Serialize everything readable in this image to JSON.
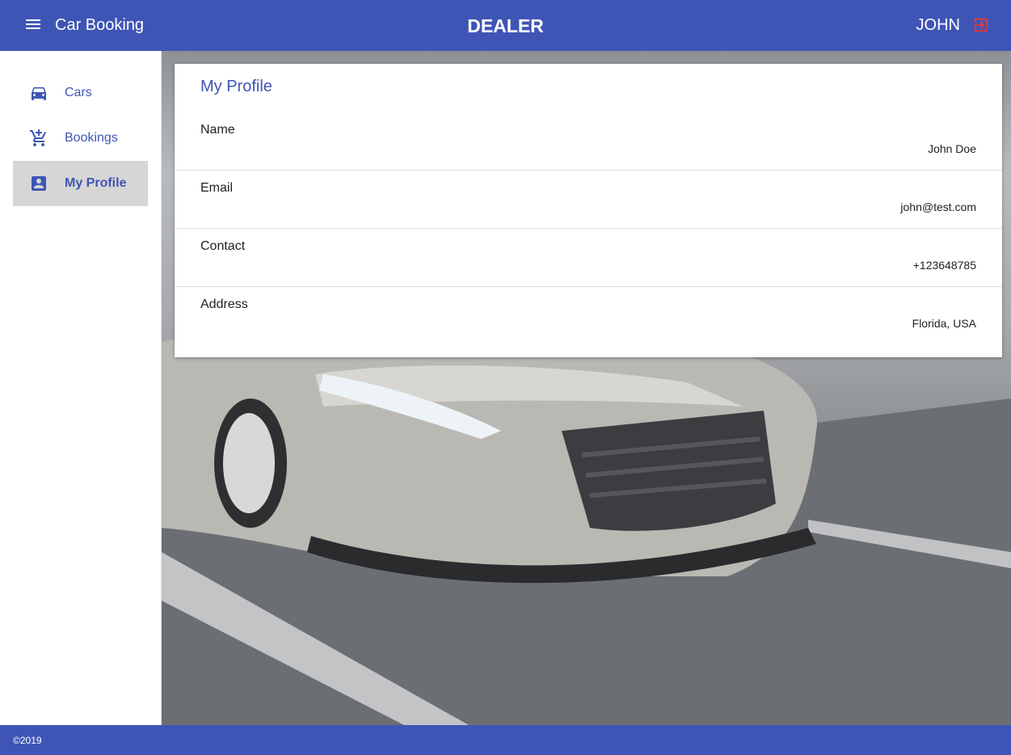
{
  "header": {
    "app_title": "Car Booking",
    "role": "DEALER",
    "user": "JOHN",
    "icons": {
      "menu": "menu-icon",
      "logout": "logout-icon"
    },
    "colors": {
      "bar": "#3f55b5",
      "logout_icon": "#e53935"
    }
  },
  "sidebar": {
    "items": [
      {
        "label": "Cars",
        "icon": "car-icon",
        "active": false
      },
      {
        "label": "Bookings",
        "icon": "add-shopping-cart-icon",
        "active": false
      },
      {
        "label": "My Profile",
        "icon": "account-box-icon",
        "active": true
      }
    ]
  },
  "profile": {
    "title": "My Profile",
    "fields": [
      {
        "label": "Name",
        "value": "John Doe"
      },
      {
        "label": "Email",
        "value": "john@test.com"
      },
      {
        "label": "Contact",
        "value": "+123648785"
      },
      {
        "label": "Address",
        "value": "Florida, USA"
      }
    ]
  },
  "footer": {
    "copyright": "©2019"
  }
}
